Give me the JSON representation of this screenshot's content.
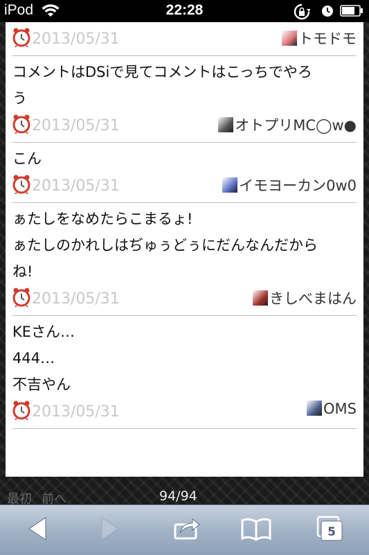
{
  "status_bar": {
    "carrier": "iPod",
    "time": "22:28",
    "icons": [
      "wifi-icon",
      "rotation-lock-icon",
      "alarm-clock-icon",
      "battery-icon"
    ]
  },
  "comments": [
    {
      "lines": [],
      "date": "2013/05/31",
      "user": "トモドモ",
      "avatar_color": "#d9727a"
    },
    {
      "lines": [
        "コメントはDSiで見てコメントはこっちでやろ",
        "う"
      ],
      "date": "2013/05/31",
      "user": "オトプリMC◯w●",
      "avatar_color": "#555555"
    },
    {
      "lines": [
        "こん"
      ],
      "date": "2013/05/31",
      "user": "イモヨーカン0w0",
      "avatar_color": "#5a6fc7"
    },
    {
      "lines": [
        "ぁたしをなめたらこまるょ!",
        "ぁたしのかれしはぢゅぅどぅにだんなんだから",
        "ね!"
      ],
      "date": "2013/05/31",
      "user": "きしべまはん",
      "avatar_color": "#a0302a"
    },
    {
      "lines": [
        "KEさん…",
        "444…",
        "不吉やん"
      ],
      "date": "2013/05/31",
      "user": "OMS",
      "avatar_color": "#4b5d8a"
    }
  ],
  "paging": {
    "first": "最初",
    "prev": "前へ",
    "count": "94/94"
  },
  "toolbar": {
    "tabs_count": "5",
    "buttons": [
      "back-icon",
      "forward-icon",
      "share-icon",
      "bookmarks-icon",
      "tabs-icon"
    ]
  },
  "colors": {
    "date_gray": "#c8c8c8",
    "alarm_red": "#d33a2c",
    "toolbar_blue": "#a3b3c6"
  }
}
